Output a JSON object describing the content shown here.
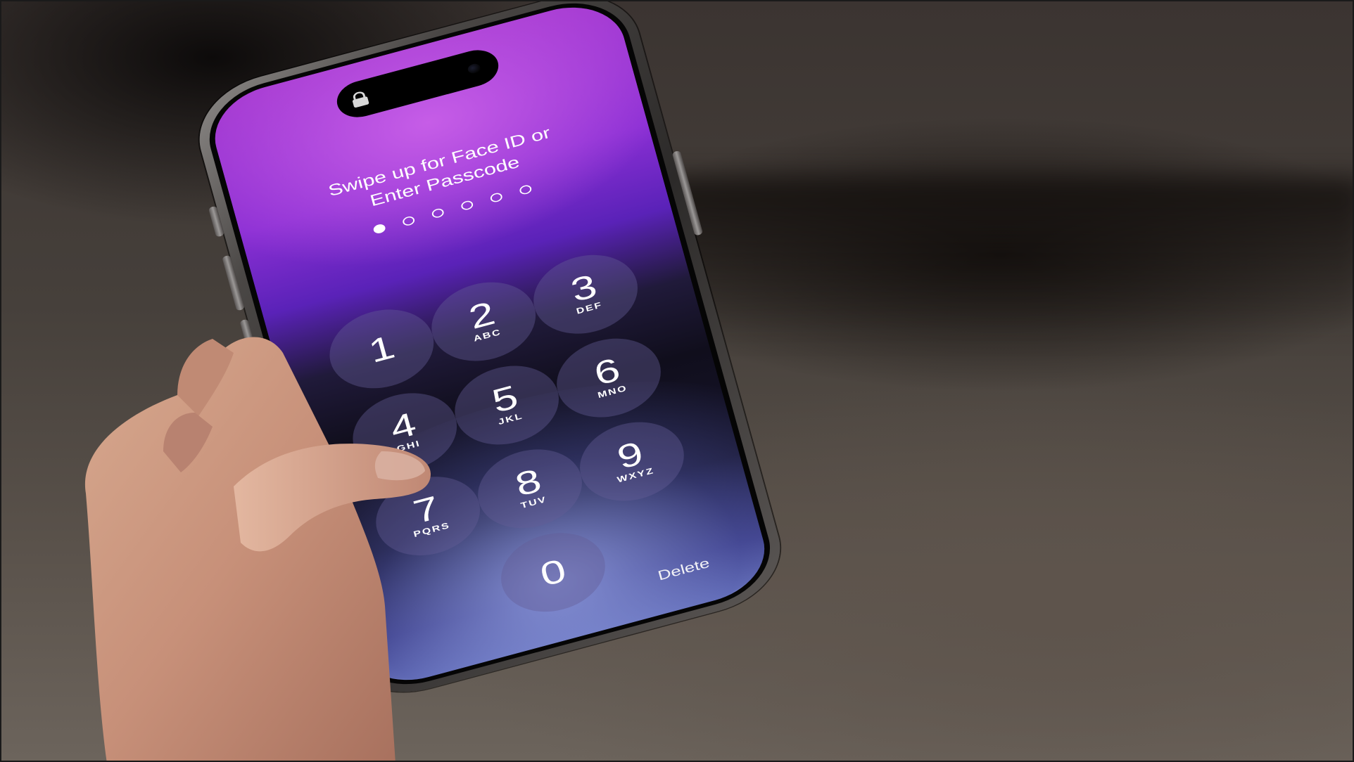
{
  "lock_screen": {
    "prompt_line1": "Swipe up for Face ID or",
    "prompt_line2": "Enter Passcode",
    "passcode_length": 6,
    "digits_entered": 1,
    "delete_label": "Delete"
  },
  "keypad": {
    "keys": [
      {
        "digit": "1",
        "letters": ""
      },
      {
        "digit": "2",
        "letters": "ABC"
      },
      {
        "digit": "3",
        "letters": "DEF"
      },
      {
        "digit": "4",
        "letters": "GHI"
      },
      {
        "digit": "5",
        "letters": "JKL"
      },
      {
        "digit": "6",
        "letters": "MNO"
      },
      {
        "digit": "7",
        "letters": "PQRS"
      },
      {
        "digit": "8",
        "letters": "TUV"
      },
      {
        "digit": "9",
        "letters": "WXYZ"
      },
      {
        "digit": "0",
        "letters": ""
      }
    ]
  },
  "icons": {
    "island_lock": "lock-icon"
  },
  "colors": {
    "wallpaper_top": "#a53ad1",
    "wallpaper_mid": "#100e1c",
    "wallpaper_bottom": "#6f7bc2",
    "key_fill": "#645c96",
    "text": "#ffffff"
  }
}
